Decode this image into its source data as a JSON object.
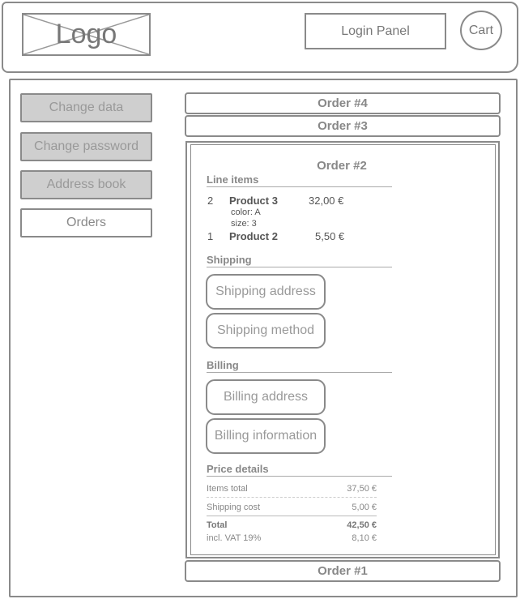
{
  "header": {
    "logo_text": "Logo",
    "login_label": "Login Panel",
    "cart_label": "Cart"
  },
  "nav": {
    "items": [
      {
        "label": "Change data",
        "active": false
      },
      {
        "label": "Change password",
        "active": false
      },
      {
        "label": "Address book",
        "active": false
      },
      {
        "label": "Orders",
        "active": true
      }
    ]
  },
  "orders": {
    "collapsed": [
      "Order #4",
      "Order #3",
      "Order #1"
    ],
    "expanded": {
      "title": "Order #2",
      "line_items_heading": "Line items",
      "line_items": [
        {
          "qty": "2",
          "name": "Product 3",
          "price": "32,00 €",
          "attrs": [
            "color: A",
            "size: 3"
          ]
        },
        {
          "qty": "1",
          "name": "Product 2",
          "price": "5,50 €",
          "attrs": []
        }
      ],
      "shipping_heading": "Shipping",
      "shipping_buttons": [
        "Shipping address",
        "Shipping method"
      ],
      "billing_heading": "Billing",
      "billing_buttons": [
        "Billing address",
        "Billing information"
      ],
      "price_details_heading": "Price details",
      "price_details": [
        {
          "label": "Items total",
          "value": "37,50 €"
        },
        {
          "label": "Shipping cost",
          "value": "5,00 €"
        },
        {
          "label": "Total",
          "value": "42,50 €"
        },
        {
          "label": "incl. VAT 19%",
          "value": "8,10 €"
        }
      ]
    }
  }
}
